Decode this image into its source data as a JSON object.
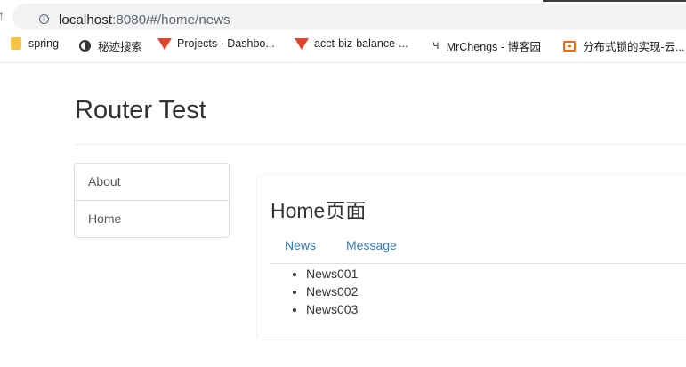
{
  "browser": {
    "url_host": "localhost",
    "url_rest": ":8080/#/home/news",
    "bookmarks": [
      {
        "label": "spring",
        "icon": "folder-icon"
      },
      {
        "label": "秘迹搜索",
        "icon": "mijisou-icon"
      },
      {
        "label": "Projects · Dashbo...",
        "icon": "gitlab-icon"
      },
      {
        "label": "acct-biz-balance-...",
        "icon": "gitlab-icon"
      },
      {
        "label": "MrChengs - 博客园",
        "icon": "cnblogs-icon"
      },
      {
        "label": "分布式锁的实现-云...",
        "icon": "aliyun-icon"
      }
    ]
  },
  "app": {
    "title": "Router Test",
    "nav": [
      {
        "label": "About"
      },
      {
        "label": "Home"
      }
    ]
  },
  "home": {
    "heading": "Home页面",
    "tabs": [
      {
        "label": "News"
      },
      {
        "label": "Message"
      }
    ],
    "news": [
      {
        "label": "News001"
      },
      {
        "label": "News002"
      },
      {
        "label": "News003"
      }
    ]
  },
  "colors": {
    "link": "#337ab7",
    "border": "#dddddd",
    "gitlab": "#e2432a",
    "aliyun": "#ff6a00"
  }
}
